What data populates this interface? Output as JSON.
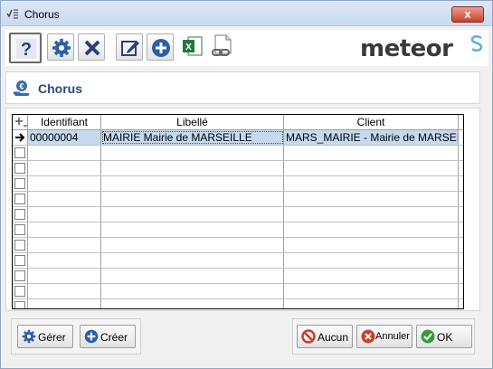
{
  "window": {
    "title": "Chorus",
    "close_label": "x"
  },
  "toolbar": {
    "logo_text": "meteor",
    "buttons": [
      "help",
      "settings",
      "cancel",
      "edit",
      "add",
      "excel",
      "link"
    ]
  },
  "section": {
    "title": "Chorus"
  },
  "grid": {
    "columns": [
      "Identifiant",
      "Libellé",
      "Client"
    ],
    "rows": [
      {
        "id": "00000004",
        "libelle": "MAIRIE Mairie de MARSEILLE",
        "client": "MARS_MAIRIE - Mairie de MARSEILLE"
      }
    ]
  },
  "buttons": {
    "gerer": "Gérer",
    "creer": "Créer",
    "aucun": "Aucun",
    "annuler": "Annuler",
    "ok": "OK"
  },
  "colors": {
    "accent": "#2a6fb5",
    "selection": "#c5d9ef",
    "danger": "#c9412a",
    "ok": "#3a9a3a"
  }
}
